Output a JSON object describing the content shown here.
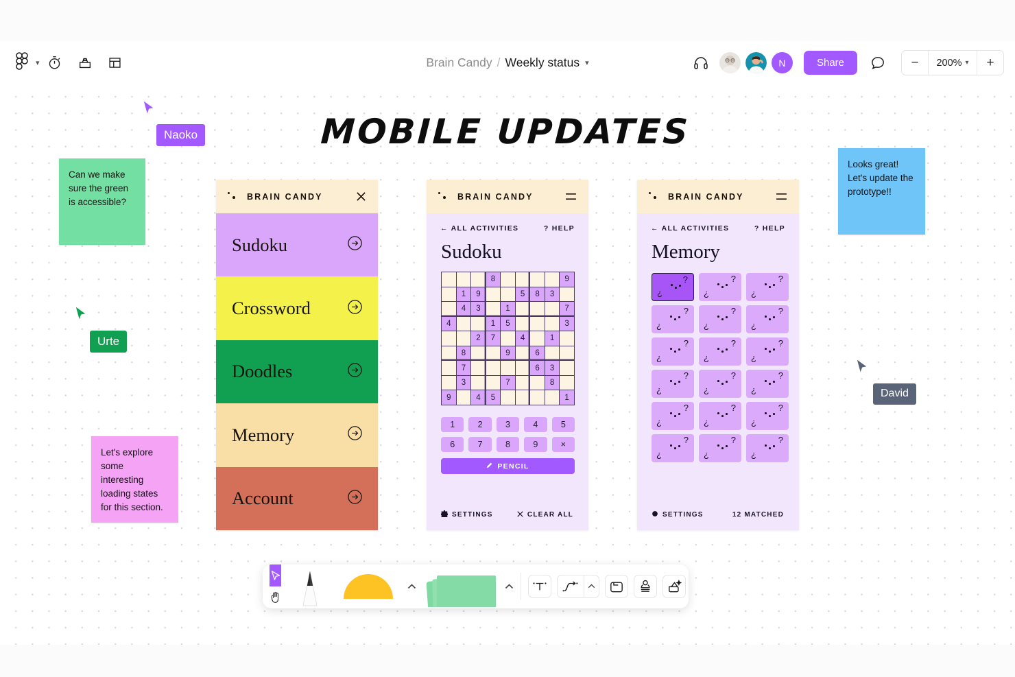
{
  "app": {
    "name": "figma-board",
    "logo_icon": "figma-logo-icon",
    "main_menu_chevron": "chevron-down-icon"
  },
  "toolbar_top": {
    "tools": [
      {
        "icon": "stopwatch-icon",
        "name": "timer-tool"
      },
      {
        "icon": "toolbox-icon",
        "name": "templates-tool"
      },
      {
        "icon": "layout-icon",
        "name": "layout-tool"
      }
    ],
    "breadcrumb": {
      "project": "Brain Candy",
      "separator": "/",
      "page": "Weekly status",
      "chevron": "chevron-down-icon"
    },
    "headphones_icon": "headphones-icon",
    "collaborators": [
      {
        "name": "collab-avatar-1",
        "type": "photo"
      },
      {
        "name": "collab-avatar-2",
        "type": "photo"
      },
      {
        "name": "collab-avatar-3",
        "type": "initial",
        "initial": "N",
        "color": "#a259ff"
      }
    ],
    "share_label": "Share",
    "comment_icon": "comment-bubble-icon",
    "zoom": {
      "minus": "−",
      "value": "200%",
      "chevron": "chevron-down-icon",
      "plus": "+"
    }
  },
  "board": {
    "title": "MOBILE UPDATES",
    "sticky_notes": [
      {
        "id": "note-green",
        "text": "Can we make sure the green is accessible?",
        "color": "#74dfa2"
      },
      {
        "id": "note-pink",
        "text": "Let's explore some interesting loading states for this section.",
        "color": "#f5a3f5"
      },
      {
        "id": "note-blue",
        "text": "Looks great! Let's update the prototype!!",
        "color": "#6fc4f8"
      }
    ],
    "cursors": [
      {
        "id": "cur-naoko",
        "label": "Naoko",
        "color": "#a259ff"
      },
      {
        "id": "cur-urte",
        "label": "Urte",
        "color": "#11a052"
      },
      {
        "id": "cur-david",
        "label": "David",
        "color": "#5a6478"
      }
    ]
  },
  "screens": {
    "menu": {
      "brand": "BRAIN CANDY",
      "header_icon": "close-icon",
      "items": [
        {
          "label": "Sudoku",
          "color": "#d9a6fb"
        },
        {
          "label": "Crossword",
          "color": "#f4f24a"
        },
        {
          "label": "Doodles",
          "color": "#11a052"
        },
        {
          "label": "Memory",
          "color": "#f9dfa5"
        },
        {
          "label": "Account",
          "color": "#d4705a"
        }
      ],
      "arrow_icon": "arrow-right-circle-icon"
    },
    "sudoku": {
      "brand": "BRAIN CANDY",
      "header_icon": "hamburger-menu-icon",
      "back_label": "ALL ACTIVITIES",
      "back_icon": "arrow-left-icon",
      "help_label": "HELP",
      "help_icon": "question-mark-icon",
      "title": "Sudoku",
      "numpad": [
        "1",
        "2",
        "3",
        "4",
        "5",
        "6",
        "7",
        "8",
        "9",
        "×"
      ],
      "pencil_label": "PENCIL",
      "pencil_icon": "pencil-icon",
      "settings_label": "SETTINGS",
      "settings_icon": "gear-icon",
      "clear_label": "CLEAR ALL",
      "clear_icon": "close-icon"
    },
    "memory": {
      "brand": "BRAIN CANDY",
      "header_icon": "hamburger-menu-icon",
      "back_label": "ALL ACTIVITIES",
      "back_icon": "arrow-left-icon",
      "help_label": "HELP",
      "help_icon": "question-mark-icon",
      "title": "Memory",
      "card_face": {
        "left_glyph": "¿",
        "right_glyph": "?",
        "dots": 3
      },
      "rows": 6,
      "cols": 3,
      "selected_index": 0,
      "settings_label": "SETTINGS",
      "settings_icon": "gear-icon",
      "matched_label": "12 MATCHED"
    }
  },
  "chart_data": {
    "type": "table",
    "title": "Sudoku puzzle grid",
    "rows": 9,
    "cols": 9,
    "note": "0 = empty cell; non-zero cells are shown filled/highlighted",
    "values": [
      [
        0,
        0,
        0,
        8,
        0,
        0,
        0,
        0,
        9
      ],
      [
        0,
        1,
        9,
        0,
        0,
        5,
        8,
        3,
        0
      ],
      [
        0,
        4,
        3,
        0,
        1,
        0,
        0,
        0,
        7
      ],
      [
        4,
        0,
        0,
        1,
        5,
        0,
        0,
        0,
        3
      ],
      [
        0,
        0,
        2,
        7,
        0,
        4,
        0,
        1,
        0
      ],
      [
        0,
        8,
        0,
        0,
        9,
        0,
        6,
        0,
        0
      ],
      [
        0,
        7,
        0,
        0,
        0,
        0,
        6,
        3,
        0
      ],
      [
        0,
        3,
        0,
        0,
        7,
        0,
        0,
        8,
        0
      ],
      [
        9,
        0,
        4,
        5,
        0,
        0,
        0,
        0,
        1
      ]
    ]
  },
  "toolbar_bottom": {
    "tools": [
      {
        "name": "cursor-tool",
        "icon": "cursor-arrow-icon",
        "active": true
      },
      {
        "name": "hand-tool",
        "icon": "hand-icon",
        "active": false
      },
      {
        "name": "pencil-tool",
        "icon": "pencil-tool-icon",
        "active": false
      },
      {
        "name": "shape-tool",
        "icon": "shape-icon",
        "active": false
      },
      {
        "name": "sticky-note-tool",
        "icon": "sticky-note-stack-icon",
        "active": false
      },
      {
        "name": "text-tool",
        "icon": "text-T-icon",
        "active": false
      },
      {
        "name": "connector-tool",
        "icon": "connector-arrow-icon",
        "active": false
      },
      {
        "name": "frame-tool",
        "icon": "frame-icon",
        "active": false
      },
      {
        "name": "stamp-tool",
        "icon": "stamp-icon",
        "active": false
      },
      {
        "name": "widget-tool",
        "icon": "magic-widget-icon",
        "active": false
      }
    ],
    "chevron": "chevron-up-icon"
  }
}
